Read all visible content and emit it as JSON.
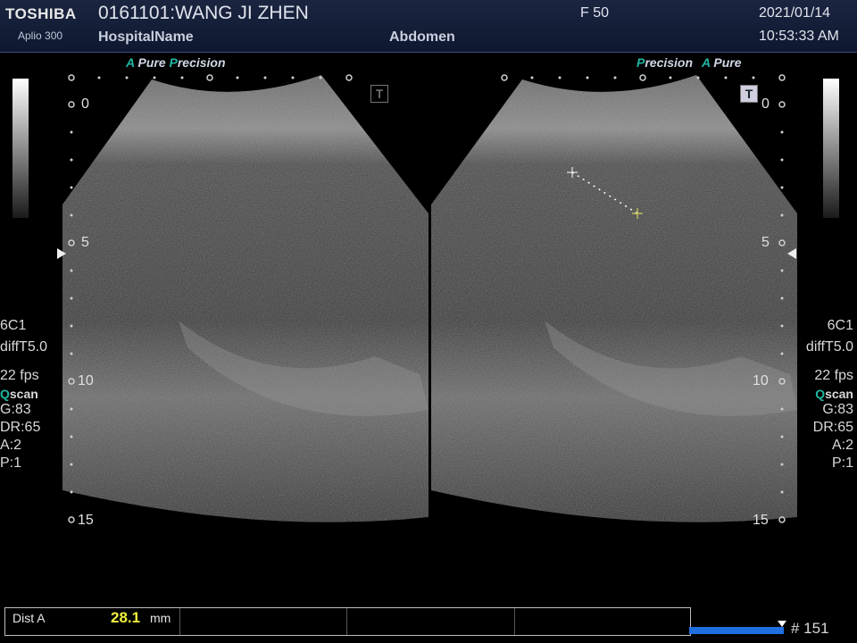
{
  "header": {
    "brand": "TOSHIBA",
    "model": "Aplio 300",
    "patient": "0161101:WANG JI ZHEN",
    "hospital": "HospitalName",
    "preset": "Abdomen",
    "frame_label": "F  50",
    "date": "2021/01/14",
    "time": "10:53:33 AM"
  },
  "left_image": {
    "tag_a": "A",
    "tag_pure": "Pure",
    "tag_p": "P",
    "tag_precision": "recision",
    "t_icon": "T"
  },
  "right_image": {
    "tag_p": "P",
    "tag_precision": "recision",
    "tag_a": "A",
    "tag_pure": "Pure",
    "t_icon": "T"
  },
  "depth_scale": {
    "d0": "0",
    "d5": "5",
    "d10": "10",
    "d15": "15"
  },
  "params": {
    "probe": "6C1",
    "mode": "diffT5.0",
    "fps": "22 fps",
    "qscan_q": "Q",
    "qscan_rest": "scan",
    "gain": "G:83",
    "dr": "DR:65",
    "a": "A:2",
    "p": "P:1"
  },
  "measurement": {
    "label": "Dist A",
    "value": "28.1",
    "unit": "mm"
  },
  "footer": {
    "frame_count": "# 151",
    "cine_progress": 1.0
  },
  "colors": {
    "accent_teal": "#1fb6a3",
    "value_yellow": "#f2ef3c",
    "header_bg": "#1b2540"
  },
  "icons": [
    "t-marker-icon",
    "focus-arrow-icon",
    "caliper-cross-icon",
    "grey-scale-bar"
  ]
}
